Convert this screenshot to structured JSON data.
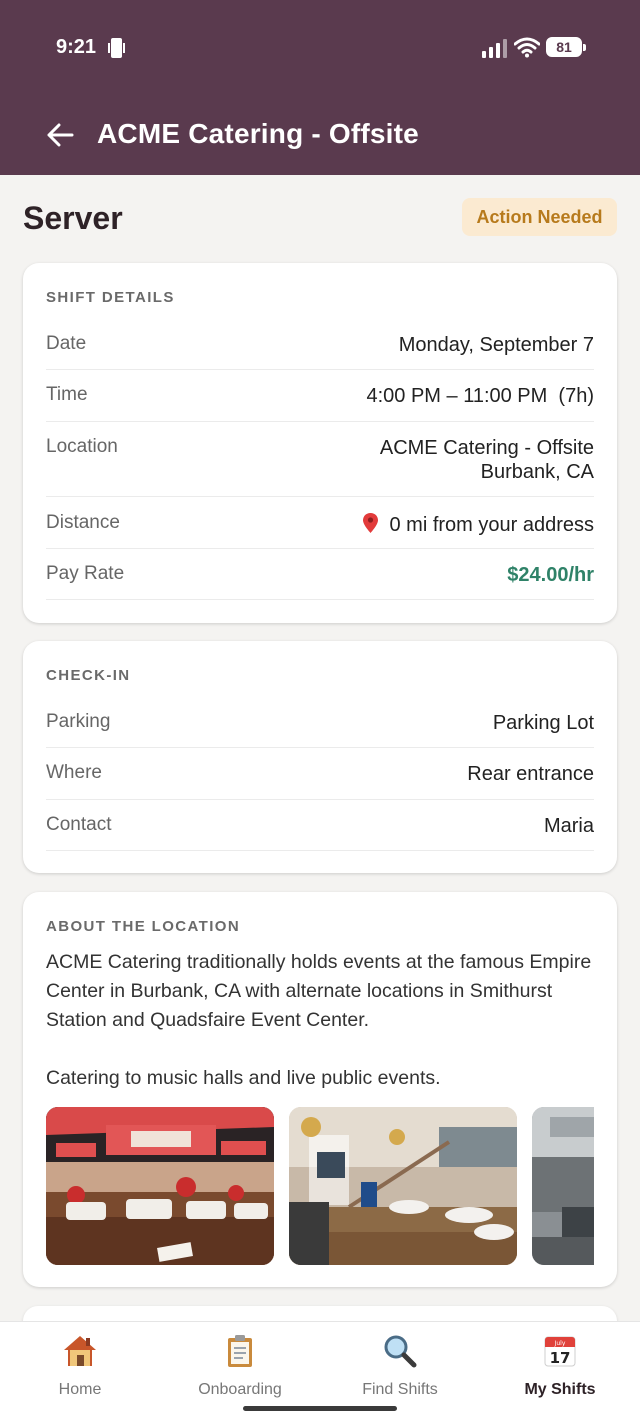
{
  "status_bar": {
    "time": "9:21",
    "battery": "81"
  },
  "header": {
    "title": "ACME Catering - Offsite"
  },
  "role": {
    "title": "Server",
    "badge": "Action Needed"
  },
  "shift_details": {
    "section_title": "SHIFT DETAILS",
    "rows": [
      {
        "label": "Date",
        "value": "Monday, September 7"
      },
      {
        "label": "Time",
        "value": "4:00 PM – 11:00 PM  (7h)"
      },
      {
        "label": "Location",
        "value": "ACME Catering - Offsite",
        "value2": "Burbank, CA"
      },
      {
        "label": "Distance",
        "value": "0 mi from your address"
      },
      {
        "label": "Pay Rate",
        "value": "$24.00/hr"
      }
    ]
  },
  "check_in": {
    "section_title": "CHECK-IN",
    "rows": [
      {
        "label": "Parking",
        "value": "Parking Lot"
      },
      {
        "label": "Where",
        "value": "Rear entrance"
      },
      {
        "label": "Contact",
        "value": "Maria"
      }
    ]
  },
  "about": {
    "section_title": "ABOUT THE LOCATION",
    "paragraph1": "ACME Catering traditionally holds events at the famous Empire Center in Burbank, CA with alternate locations in Smithurst Station and Quadsfaire Event Center.",
    "paragraph2": "Catering to music halls and live public events.",
    "photos": [
      "ballroom-photo",
      "atrium-hall-photo",
      "kitchen-photo"
    ]
  },
  "bottom_nav": {
    "items": [
      {
        "label": "Home",
        "icon": "house-icon"
      },
      {
        "label": "Onboarding",
        "icon": "clipboard-icon"
      },
      {
        "label": "Find Shifts",
        "icon": "magnifier-icon"
      },
      {
        "label": "My Shifts",
        "icon": "calendar-icon",
        "active": true,
        "calendar_month": "July",
        "calendar_day": "17"
      }
    ]
  },
  "colors": {
    "header": "#5a3a4e",
    "badge_bg": "#fbead1",
    "badge_text": "#b77a1c",
    "pay": "#2f8268"
  }
}
